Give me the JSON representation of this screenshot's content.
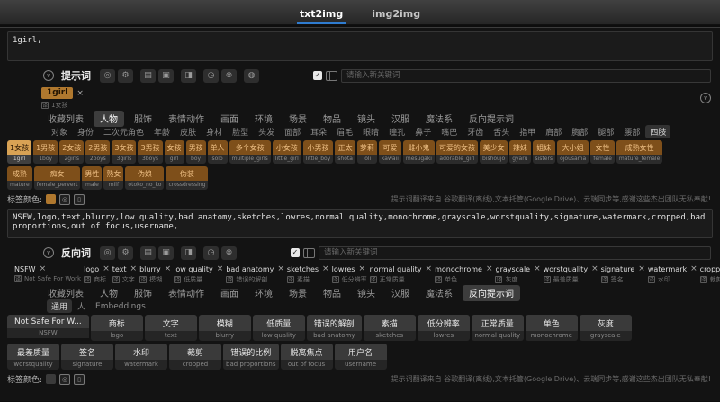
{
  "header": {
    "tabs": [
      {
        "label": "txt2img",
        "active": true
      },
      {
        "label": "img2img",
        "active": false
      }
    ]
  },
  "help_text": "提示词翻译来自 谷歌翻译(离线),文本托管(Google Drive)、云端同步等,感谢这些杰出团队无私奉献!",
  "colors": {
    "tab_underline": "#2f7cd0",
    "positive_tag_color": "#b0782e",
    "negative_tag_color": "#3a3a3a"
  },
  "positive": {
    "label": "提示词",
    "textarea_value": "1girl,",
    "input_placeholder": "请输入新关键词",
    "tag_color_label": "标签颜色:",
    "toolbar_icon_groups": [
      [
        {
          "name": "translate-toggle-icon",
          "glyph": "◎"
        },
        {
          "name": "settings-icon",
          "glyph": "⚙"
        }
      ],
      [
        {
          "name": "save-preset-icon",
          "glyph": "▤"
        },
        {
          "name": "load-preset-icon",
          "glyph": "▣"
        }
      ],
      [
        {
          "name": "image-info-icon",
          "glyph": "◨"
        }
      ],
      [
        {
          "name": "history-icon",
          "glyph": "◷"
        },
        {
          "name": "clear-icon",
          "glyph": "⊗"
        }
      ],
      [
        {
          "name": "help-icon",
          "glyph": "◍"
        }
      ]
    ],
    "chips": [
      {
        "text": "1girl",
        "translation": "1女孩"
      }
    ],
    "tabs": [
      {
        "label": "收藏列表",
        "active": false
      },
      {
        "label": "人物",
        "active": true
      },
      {
        "label": "服饰",
        "active": false
      },
      {
        "label": "表情动作",
        "active": false
      },
      {
        "label": "画面",
        "active": false
      },
      {
        "label": "环境",
        "active": false
      },
      {
        "label": "场景",
        "active": false
      },
      {
        "label": "物品",
        "active": false
      },
      {
        "label": "镜头",
        "active": false
      },
      {
        "label": "汉服",
        "active": false
      },
      {
        "label": "魔法系",
        "active": false
      },
      {
        "label": "反向提示词",
        "active": false
      }
    ],
    "subcategories": [
      {
        "label": "对象",
        "active": false
      },
      {
        "label": "身份",
        "active": false
      },
      {
        "label": "二次元角色",
        "active": false
      },
      {
        "label": "年龄",
        "active": false
      },
      {
        "label": "皮肤",
        "active": false
      },
      {
        "label": "身材",
        "active": false
      },
      {
        "label": "脸型",
        "active": false
      },
      {
        "label": "头发",
        "active": false
      },
      {
        "label": "面部",
        "active": false
      },
      {
        "label": "耳朵",
        "active": false
      },
      {
        "label": "眉毛",
        "active": false
      },
      {
        "label": "眼睛",
        "active": false
      },
      {
        "label": "瞳孔",
        "active": false
      },
      {
        "label": "鼻子",
        "active": false
      },
      {
        "label": "嘴巴",
        "active": false
      },
      {
        "label": "牙齿",
        "active": false
      },
      {
        "label": "舌头",
        "active": false
      },
      {
        "label": "指甲",
        "active": false
      },
      {
        "label": "肩部",
        "active": false
      },
      {
        "label": "胸部",
        "active": false
      },
      {
        "label": "腿部",
        "active": false
      },
      {
        "label": "腰部",
        "active": false
      },
      {
        "label": "四肢",
        "active": true
      }
    ],
    "tag_rows": [
      [
        {
          "zh": "1女孩",
          "en": "1girl",
          "selected": true
        },
        {
          "zh": "1男孩",
          "en": "1boy"
        },
        {
          "zh": "2女孩",
          "en": "2girls"
        },
        {
          "zh": "2男孩",
          "en": "2boys"
        },
        {
          "zh": "3女孩",
          "en": "3girls"
        },
        {
          "zh": "3男孩",
          "en": "3boys"
        },
        {
          "zh": "女孩",
          "en": "girl"
        },
        {
          "zh": "男孩",
          "en": "boy"
        },
        {
          "zh": "单人",
          "en": "solo"
        },
        {
          "zh": "多个女孩",
          "en": "multiple_girls"
        },
        {
          "zh": "小女孩",
          "en": "little_girl"
        },
        {
          "zh": "小男孩",
          "en": "little_boy"
        },
        {
          "zh": "正太",
          "en": "shota"
        },
        {
          "zh": "萝莉",
          "en": "loli"
        },
        {
          "zh": "可爱",
          "en": "kawaii"
        },
        {
          "zh": "雌小鬼",
          "en": "mesugaki"
        },
        {
          "zh": "可爱的女孩",
          "en": "adorable_girl"
        },
        {
          "zh": "美少女",
          "en": "bishoujo"
        },
        {
          "zh": "辣妹",
          "en": "gyaru"
        },
        {
          "zh": "姐妹",
          "en": "sisters"
        },
        {
          "zh": "大小姐",
          "en": "ojousama"
        },
        {
          "zh": "女性",
          "en": "female"
        },
        {
          "zh": "成熟女性",
          "en": "mature_female"
        }
      ],
      [
        {
          "zh": "成熟",
          "en": "mature"
        },
        {
          "zh": "痴女",
          "en": "female_pervert"
        },
        {
          "zh": "男性",
          "en": "male"
        },
        {
          "zh": "熟女",
          "en": "milf"
        },
        {
          "zh": "伪娘",
          "en": "otoko_no_ko"
        },
        {
          "zh": "伪装",
          "en": "crossdressing"
        }
      ]
    ]
  },
  "negative": {
    "label": "反向词",
    "textarea_value": "NSFW,logo,text,blurry,low quality,bad anatomy,sketches,lowres,normal quality,monochrome,grayscale,worstquality,signature,watermark,cropped,bad proportions,out of focus,username,",
    "input_placeholder": "请输入新关键词",
    "tag_color_label": "标签颜色:",
    "toolbar_icon_groups": [
      [
        {
          "name": "translate-toggle-icon",
          "glyph": "◎"
        },
        {
          "name": "settings-icon",
          "glyph": "⚙"
        }
      ],
      [
        {
          "name": "save-preset-icon",
          "glyph": "▤"
        },
        {
          "name": "load-preset-icon",
          "glyph": "▣"
        }
      ],
      [
        {
          "name": "image-info-icon",
          "glyph": "◨"
        }
      ],
      [
        {
          "name": "history-icon",
          "glyph": "◷"
        },
        {
          "name": "clear-icon",
          "glyph": "⊗"
        }
      ]
    ],
    "chips": [
      {
        "text": "NSFW",
        "translation": "Not Safe For Work"
      },
      {
        "text": "logo",
        "translation": "商标"
      },
      {
        "text": "text",
        "translation": "文字"
      },
      {
        "text": "blurry",
        "translation": "模糊"
      },
      {
        "text": "low quality",
        "translation": "低质量"
      },
      {
        "text": "bad anatomy",
        "translation": "错误的解剖"
      },
      {
        "text": "sketches",
        "translation": "素描"
      },
      {
        "text": "lowres",
        "translation": "低分辨率"
      },
      {
        "text": "normal quality",
        "translation": "正常质量"
      },
      {
        "text": "monochrome",
        "translation": "单色"
      },
      {
        "text": "grayscale",
        "translation": "灰度"
      },
      {
        "text": "worstquality",
        "translation": "最差质量"
      },
      {
        "text": "signature",
        "translation": "签名"
      },
      {
        "text": "watermark",
        "translation": "水印"
      },
      {
        "text": "cropped",
        "translation": "裁剪"
      },
      {
        "text": "bad proportions",
        "translation": "错误的比例"
      },
      {
        "text": "out of focus",
        "translation": "脱离焦点"
      },
      {
        "text": "username",
        "translation": "用户名"
      }
    ],
    "tabs": [
      {
        "label": "收藏列表",
        "active": false
      },
      {
        "label": "人物",
        "active": false
      },
      {
        "label": "服饰",
        "active": false
      },
      {
        "label": "表情动作",
        "active": false
      },
      {
        "label": "画面",
        "active": false
      },
      {
        "label": "环境",
        "active": false
      },
      {
        "label": "场景",
        "active": false
      },
      {
        "label": "物品",
        "active": false
      },
      {
        "label": "镜头",
        "active": false
      },
      {
        "label": "汉服",
        "active": false
      },
      {
        "label": "魔法系",
        "active": false
      },
      {
        "label": "反向提示词",
        "active": true
      }
    ],
    "subcategories": [
      {
        "label": "通用",
        "active": true
      },
      {
        "label": "人",
        "active": false
      },
      {
        "label": "Embeddings",
        "active": false
      }
    ],
    "tag_rows": [
      [
        {
          "zh": "Not Safe For W...",
          "en": "NSFW",
          "selected": true
        },
        {
          "zh": "商标",
          "en": "logo",
          "selected": true
        },
        {
          "zh": "文字",
          "en": "text",
          "selected": true
        },
        {
          "zh": "模糊",
          "en": "blurry",
          "selected": true
        },
        {
          "zh": "低质量",
          "en": "low quality",
          "selected": true
        },
        {
          "zh": "错误的解剖",
          "en": "bad anatomy",
          "selected": true
        },
        {
          "zh": "素描",
          "en": "sketches",
          "selected": true
        },
        {
          "zh": "低分辨率",
          "en": "lowres",
          "selected": true
        },
        {
          "zh": "正常质量",
          "en": "normal quality",
          "selected": true
        },
        {
          "zh": "单色",
          "en": "monochrome",
          "selected": true
        },
        {
          "zh": "灰度",
          "en": "grayscale",
          "selected": true
        }
      ],
      [
        {
          "zh": "最差质量",
          "en": "worstquality",
          "selected": true
        },
        {
          "zh": "签名",
          "en": "signature",
          "selected": true
        },
        {
          "zh": "水印",
          "en": "watermark",
          "selected": true
        },
        {
          "zh": "裁剪",
          "en": "cropped",
          "selected": true
        },
        {
          "zh": "错误的比例",
          "en": "bad proportions",
          "selected": true
        },
        {
          "zh": "脱离焦点",
          "en": "out of focus",
          "selected": true
        },
        {
          "zh": "用户名",
          "en": "username",
          "selected": true
        }
      ]
    ]
  }
}
